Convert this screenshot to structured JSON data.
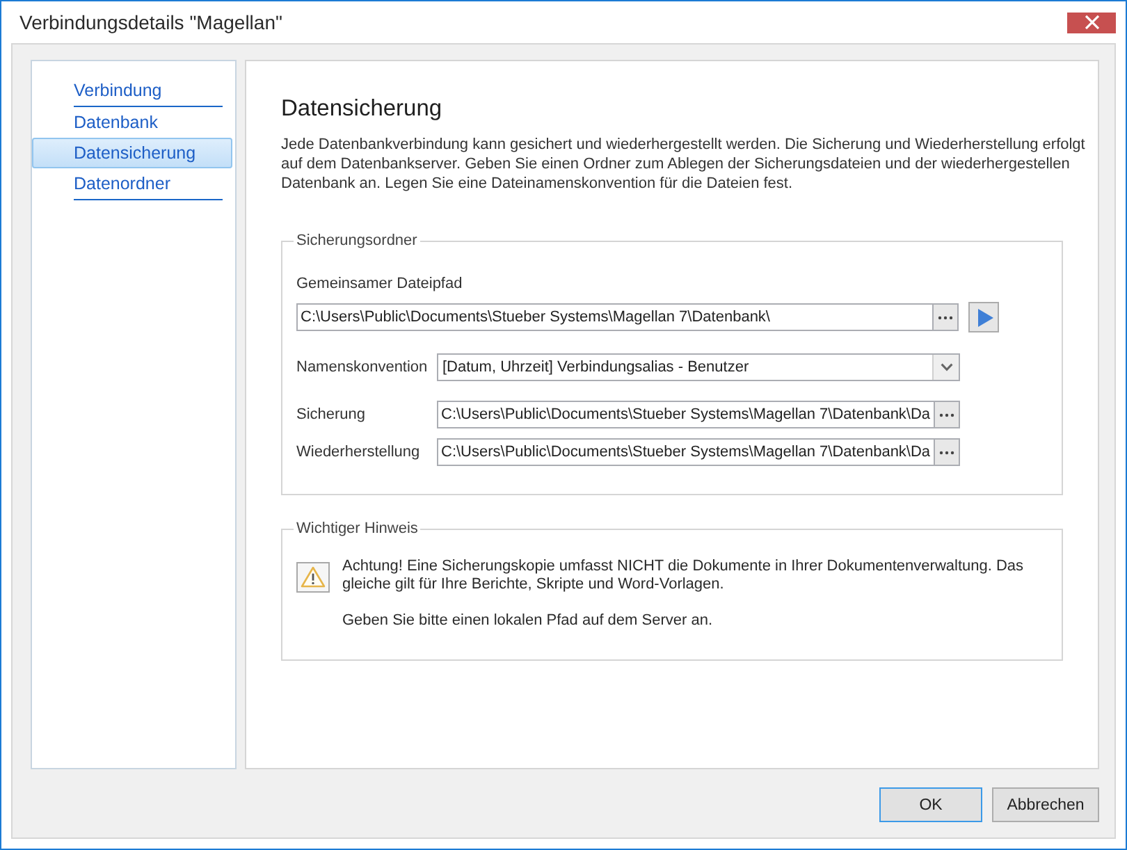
{
  "window": {
    "title": "Verbindungsdetails \"Magellan\""
  },
  "sidebar": {
    "items": [
      {
        "label": "Verbindung",
        "selected": false,
        "divider_below": true
      },
      {
        "label": "Datenbank",
        "selected": false,
        "divider_below": false
      },
      {
        "label": "Datensicherung",
        "selected": true,
        "divider_below": false
      },
      {
        "label": "Datenordner",
        "selected": false,
        "divider_below": true
      }
    ]
  },
  "page": {
    "heading": "Datensicherung",
    "description": "Jede Datenbankverbindung kann gesichert und wiederhergestellt werden. Die Sicherung und Wiederherstellung erfolgt auf dem Datenbankserver. Geben Sie einen Ordner zum Ablegen der Sicherungsdateien und der wiederhergestellen Datenbank an. Legen Sie eine Dateinamenskonvention für die Dateien fest."
  },
  "backup_folder": {
    "title": "Sicherungsordner",
    "shared_path": {
      "label": "Gemeinsamer Dateipfad",
      "value": "C:\\Users\\Public\\Documents\\Stueber Systems\\Magellan 7\\Datenbank\\"
    },
    "naming_convention": {
      "label": "Namenskonvention",
      "value": "[Datum, Uhrzeit] Verbindungsalias - Benutzer"
    },
    "paths": [
      {
        "label": "Sicherung",
        "value": "C:\\Users\\Public\\Documents\\Stueber Systems\\Magellan 7\\Datenbank\\Da"
      },
      {
        "label": "Wiederherstellung",
        "value": "C:\\Users\\Public\\Documents\\Stueber Systems\\Magellan 7\\Datenbank\\Da"
      }
    ]
  },
  "notice": {
    "title": "Wichtiger Hinweis",
    "paragraphs": [
      "Achtung! Eine Sicherungskopie umfasst NICHT die Dokumente in Ihrer Dokumentenverwaltung. Das gleiche gilt für Ihre Berichte, Skripte und Word-Vorlagen.",
      "Geben Sie bitte einen lokalen Pfad auf dem Server an."
    ]
  },
  "buttons": [
    {
      "label": "OK",
      "default": true
    },
    {
      "label": "Abbrechen",
      "default": false
    }
  ]
}
